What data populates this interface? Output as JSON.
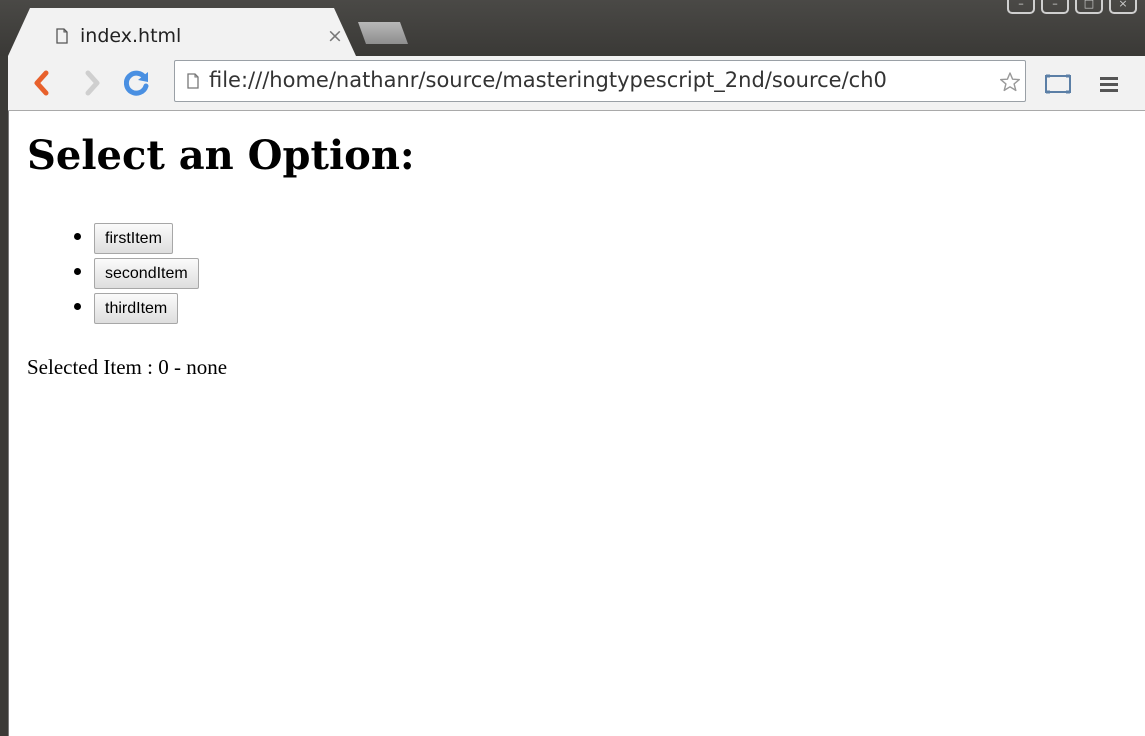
{
  "tab": {
    "title": "index.html",
    "close": "×"
  },
  "window_controls": [
    "–",
    "–",
    "□",
    "×"
  ],
  "address_bar": {
    "url": "file:///home/nathanr/source/masteringtypescript_2nd/source/ch0"
  },
  "page": {
    "heading": "Select an Option:",
    "options": [
      "firstItem",
      "secondItem",
      "thirdItem"
    ],
    "selected_text": "Selected Item : 0 - none"
  },
  "colors": {
    "titlebar": "#3b3a37",
    "toolbar": "#f2f2f2",
    "back_arrow": "#e8612c",
    "reload": "#4a90e2"
  },
  "icons": [
    "page-icon",
    "back-arrow-icon",
    "forward-arrow-icon",
    "reload-icon",
    "star-icon",
    "cast-icon",
    "menu-icon"
  ]
}
